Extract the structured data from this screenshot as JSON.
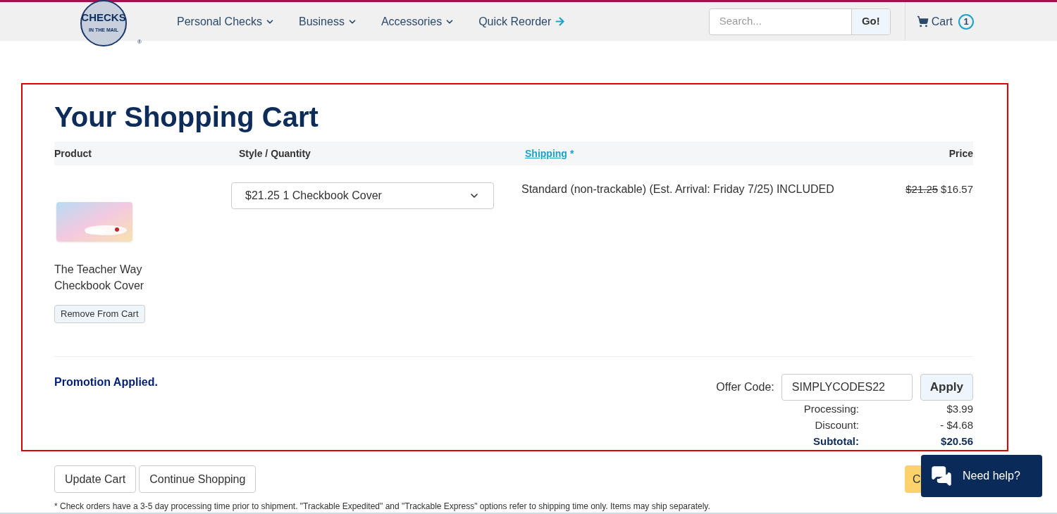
{
  "header": {
    "logo": {
      "main": "CHECKS",
      "sub": "IN THE MAIL",
      "mark": "®"
    },
    "nav": [
      {
        "label": "Personal Checks",
        "kind": "dropdown"
      },
      {
        "label": "Business",
        "kind": "dropdown"
      },
      {
        "label": "Accessories",
        "kind": "dropdown"
      },
      {
        "label": "Quick Reorder",
        "kind": "arrow"
      }
    ],
    "search": {
      "placeholder": "Search...",
      "button": "Go!"
    },
    "cart": {
      "label": "Cart",
      "count": "1"
    }
  },
  "cart": {
    "title": "Your Shopping Cart",
    "columns": [
      {
        "label": "Product",
        "kind": "plain"
      },
      {
        "label": "Style / Quantity",
        "kind": "plain"
      },
      {
        "label": "Shipping",
        "kind": "link",
        "mark": "*"
      },
      {
        "label": "Price",
        "kind": "plain"
      }
    ],
    "items": [
      {
        "name": "The Teacher Way Checkbook Cover",
        "remove": "Remove From Cart",
        "style": "$21.25 1 Checkbook Cover",
        "shipping": "Standard (non-trackable) (Est. Arrival: Friday 7/25) INCLUDED",
        "old_price": "$21.25",
        "price": "$16.57"
      }
    ],
    "promotion": "Promotion Applied.",
    "offer": {
      "label": "Offer Code:",
      "value": "SIMPLYCODES22",
      "button": "Apply"
    },
    "totals": [
      {
        "label": "Processing:",
        "value": "$3.99",
        "bold": false
      },
      {
        "label": "Discount:",
        "value": "- $4.68",
        "bold": false
      },
      {
        "label": "Subtotal:",
        "value": "$20.56",
        "bold": true
      }
    ]
  },
  "buttons": [
    "Update Cart",
    "Continue Shopping"
  ],
  "checkout": "C",
  "footnote": "* Check orders have a 3-5 day processing time prior to shipment. \"Trackable Expedited\" and \"Trackable Express\" options refer to shipping time only. Items may ship separately.",
  "chat": {
    "label": "Need help?"
  }
}
